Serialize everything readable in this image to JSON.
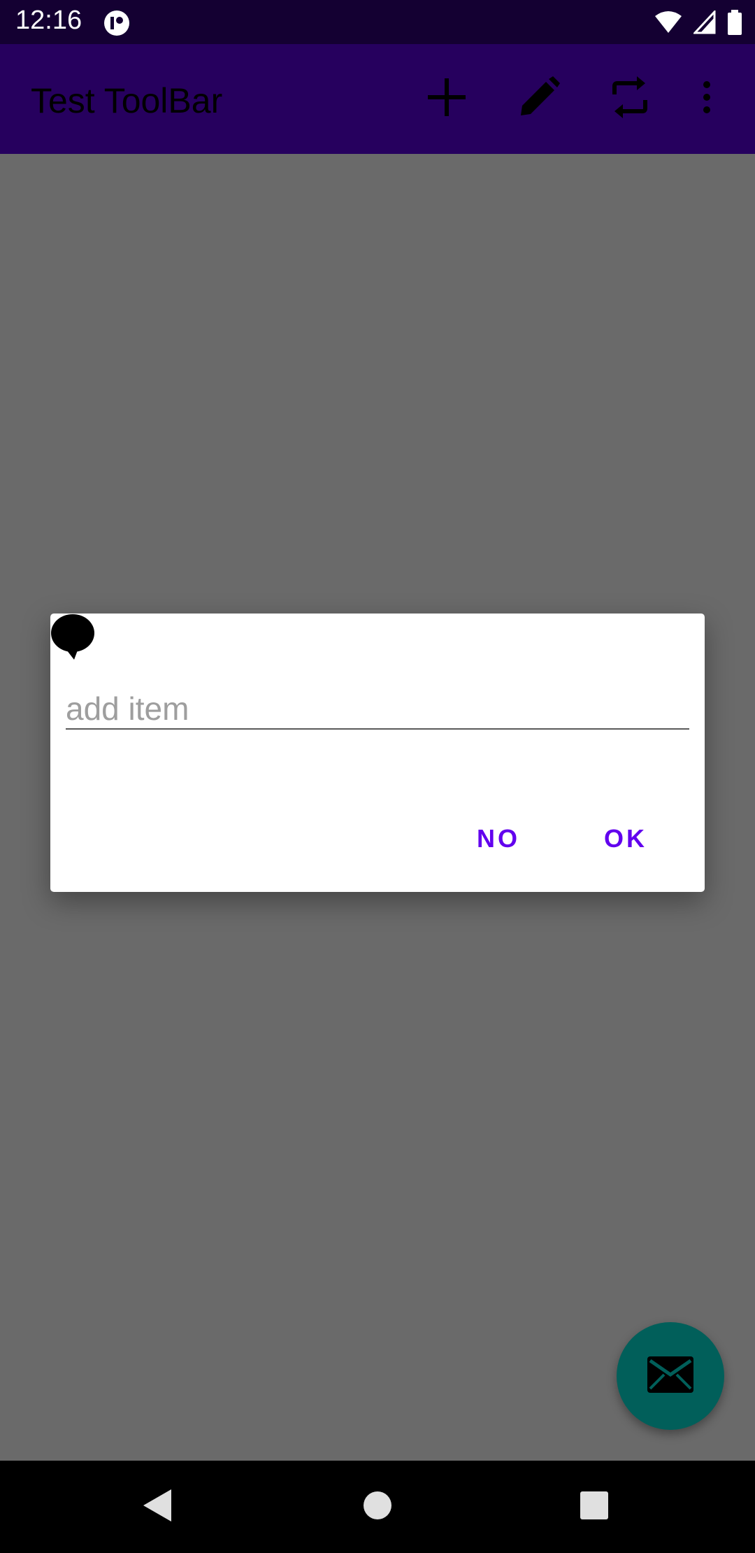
{
  "status_bar": {
    "time": "12:16",
    "icons": [
      "app-notification-icon",
      "wifi-icon",
      "cellular-signal-icon",
      "battery-icon"
    ]
  },
  "toolbar": {
    "title": "Test ToolBar",
    "actions": [
      "add-icon",
      "edit-icon",
      "refresh-icon",
      "overflow-menu-icon"
    ],
    "background": "#26005e"
  },
  "dialog": {
    "icon": "speech-bubble-icon",
    "input_placeholder": "add item",
    "input_value": "",
    "negative_label": "NO",
    "positive_label": "OK",
    "button_color": "#6200ee"
  },
  "fab": {
    "icon": "mail-icon",
    "color": "#015f5a"
  },
  "nav_bar": {
    "buttons": [
      "back-icon",
      "home-icon",
      "recents-icon"
    ]
  }
}
